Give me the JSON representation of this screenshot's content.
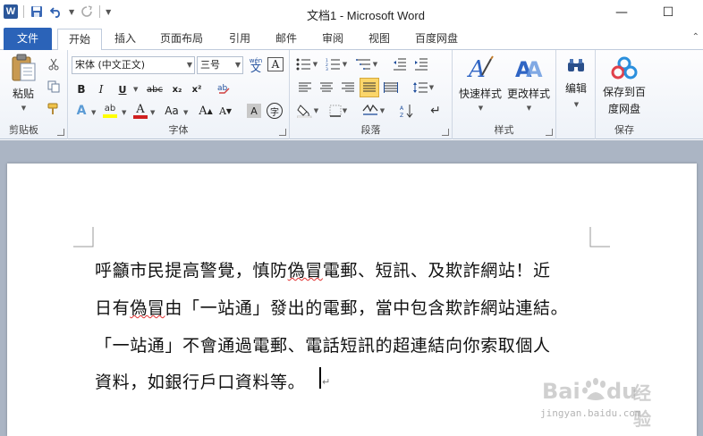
{
  "window": {
    "title": "文档1 - Microsoft Word",
    "minimize_label": "—",
    "maximize_label": "☐"
  },
  "quick_access": {
    "app_icon_text": "W",
    "save_icon": "save-icon",
    "undo_icon": "undo-icon",
    "redo_icon": "redo-icon"
  },
  "tabs": {
    "file": "文件",
    "items": [
      "开始",
      "插入",
      "页面布局",
      "引用",
      "邮件",
      "审阅",
      "视图",
      "百度网盘"
    ],
    "active_index": 0
  },
  "ribbon": {
    "clipboard": {
      "label": "剪贴板",
      "paste": "粘贴"
    },
    "font": {
      "label": "字体",
      "font_name": "宋体 (中文正文)",
      "font_size": "三号",
      "bold": "B",
      "italic": "I",
      "underline": "U",
      "strike": "abc",
      "subscript": "x₂",
      "superscript": "x²",
      "font_color": "#d02020",
      "highlight_color": "#ffff00",
      "change_case": "Aa",
      "grow": "A",
      "shrink": "A",
      "char_shading": "A",
      "enclosed": "字",
      "pinyin": "wén"
    },
    "paragraph": {
      "label": "段落"
    },
    "styles": {
      "label": "样式",
      "quick_styles": "快速样式",
      "change_styles": "更改样式"
    },
    "editing": {
      "label": "编辑"
    },
    "save": {
      "label": "保存",
      "save_to_baidu_line1": "保存到百",
      "save_to_baidu_line2": "度网盘"
    }
  },
  "document": {
    "lines": [
      "呼籲市民提高警覺，慎防偽冒電郵、短訊、及欺詐網站！近",
      "日有偽冒由「一站通」發出的電郵，當中包含欺詐網站連結。",
      "「一站通」不會通過電郵、電話短訊的超連結向你索取個人",
      "資料，如銀行戶口資料等。"
    ],
    "paragraph_mark": "↵"
  },
  "watermark": {
    "brand": "Baidu经验",
    "url": "jingyan.baidu.com"
  },
  "colors": {
    "file_tab": "#2b63b8",
    "doc_background": "#abb5c4",
    "accent_blue": "#1f4e9c"
  }
}
